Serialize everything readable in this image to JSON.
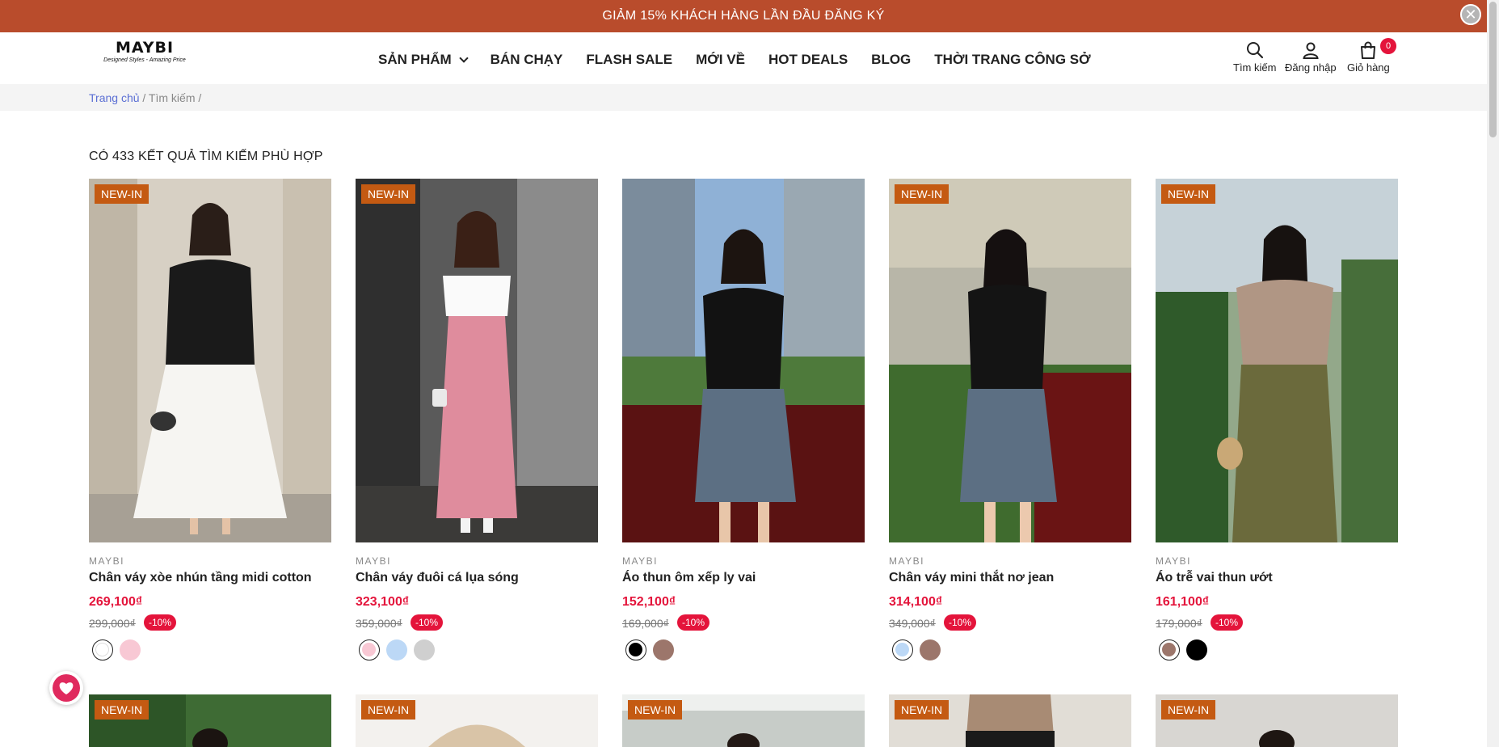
{
  "promo": {
    "text": "GIẢM 15% KHÁCH HÀNG LẦN ĐẦU ĐĂNG KÝ",
    "close_label": "✕"
  },
  "header": {
    "logo": {
      "word": "MAYBI",
      "tagline": "Designed Styles - Amazing Price"
    },
    "nav": [
      "SẢN PHẨM",
      "BÁN CHẠY",
      "FLASH SALE",
      "MỚI VỀ",
      "HOT DEALS",
      "BLOG",
      "THỜI TRANG CÔNG SỞ"
    ],
    "actions": {
      "search": "Tìm kiếm",
      "login": "Đăng nhập",
      "cart": "Giỏ hàng"
    },
    "cart_count": "0"
  },
  "breadcrumb": {
    "home": "Trang chủ",
    "current": "/ Tìm kiếm  /"
  },
  "results_title": "CÓ 433 KẾT QUẢ TÌM KIẾM PHÙ HỢP",
  "products": [
    {
      "badge": "NEW-IN",
      "brand": "MAYBI",
      "name": "Chân váy xòe nhún tầng midi cotton",
      "price": "269,100₫",
      "old_price": "299,000₫",
      "discount": "-10%",
      "swatches": [
        "#ffffff",
        "#f8c8d4"
      ]
    },
    {
      "badge": "NEW-IN",
      "brand": "MAYBI",
      "name": "Chân váy đuôi cá lụa sóng",
      "price": "323,100₫",
      "old_price": "359,000₫",
      "discount": "-10%",
      "swatches": [
        "#f8c8d4",
        "#bcd8f6",
        "#cfcfcf"
      ]
    },
    {
      "badge": "",
      "brand": "MAYBI",
      "name": "Áo thun ôm xếp ly vai",
      "price": "152,100₫",
      "old_price": "169,000₫",
      "discount": "-10%",
      "swatches": [
        "#000000",
        "#9c766b"
      ]
    },
    {
      "badge": "NEW-IN",
      "brand": "MAYBI",
      "name": "Chân váy mini thắt nơ jean",
      "price": "314,100₫",
      "old_price": "349,000₫",
      "discount": "-10%",
      "swatches": [
        "#bcd8f6",
        "#9c766b"
      ]
    },
    {
      "badge": "NEW-IN",
      "brand": "MAYBI",
      "name": "Áo trễ vai thun ướt",
      "price": "161,100₫",
      "old_price": "179,000₫",
      "discount": "-10%",
      "swatches": [
        "#9c766b",
        "#000000"
      ]
    }
  ],
  "row2_badges": [
    "NEW-IN",
    "NEW-IN",
    "NEW-IN",
    "NEW-IN",
    "NEW-IN"
  ],
  "colors": {
    "promo_bg": "#b94c2c",
    "accent_red": "#e4143b",
    "badge_orange": "#c45a12",
    "link_blue": "#5b6fd4"
  },
  "icons": {
    "search": "search-icon",
    "user": "user-icon",
    "cart": "shopping-bag-icon",
    "favorite": "heart-icon",
    "close": "close-icon",
    "dropdown": "chevron-down-icon"
  }
}
